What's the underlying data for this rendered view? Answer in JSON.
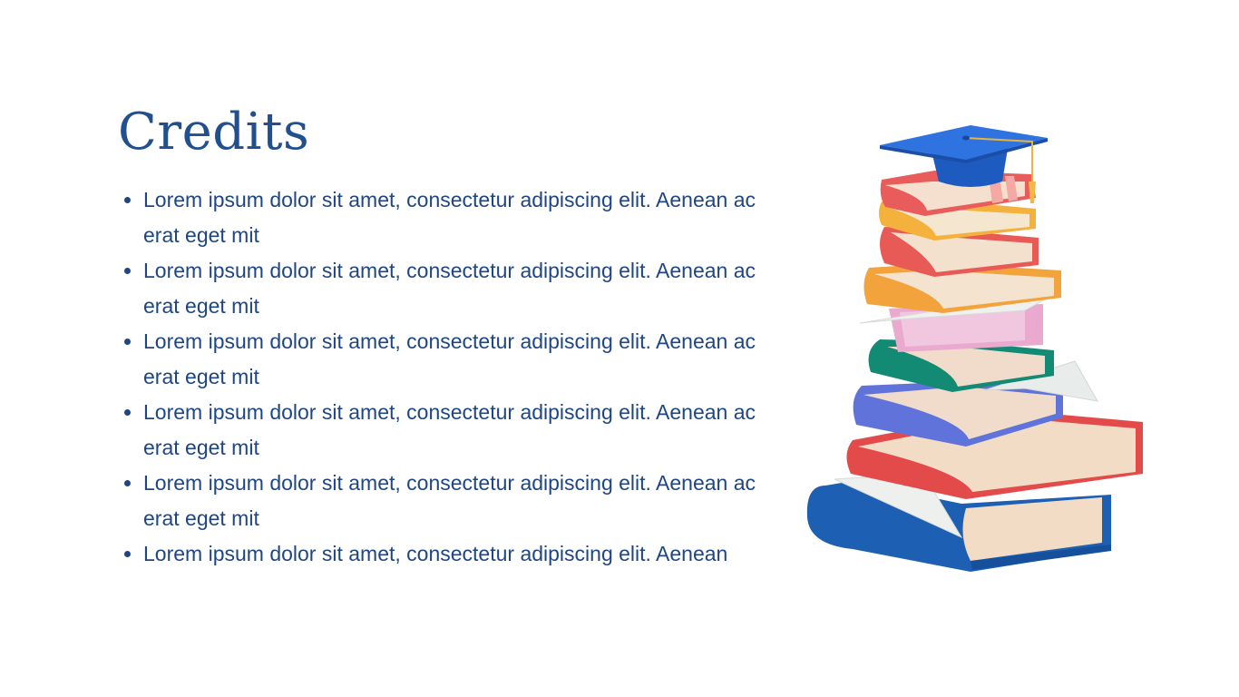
{
  "slide": {
    "title": "Credits",
    "bullets": [
      "Lorem ipsum dolor sit amet, consectetur adipiscing elit. Aenean ac erat eget mit",
      "Lorem ipsum dolor sit amet, consectetur adipiscing elit. Aenean ac erat eget mit",
      "Lorem ipsum dolor sit amet, consectetur adipiscing elit. Aenean ac erat eget mit",
      "Lorem ipsum dolor sit amet, consectetur adipiscing elit. Aenean ac erat eget mit",
      "Lorem ipsum dolor sit amet, consectetur adipiscing elit. Aenean ac erat eget mit",
      "Lorem ipsum dolor sit amet, consectetur adipiscing elit. Aenean"
    ]
  },
  "colors": {
    "title": "#22508f",
    "body_text": "#1f4684",
    "background": "#ffffff"
  },
  "illustration": {
    "icon": "stack-of-books-with-graduation-cap-icon"
  }
}
